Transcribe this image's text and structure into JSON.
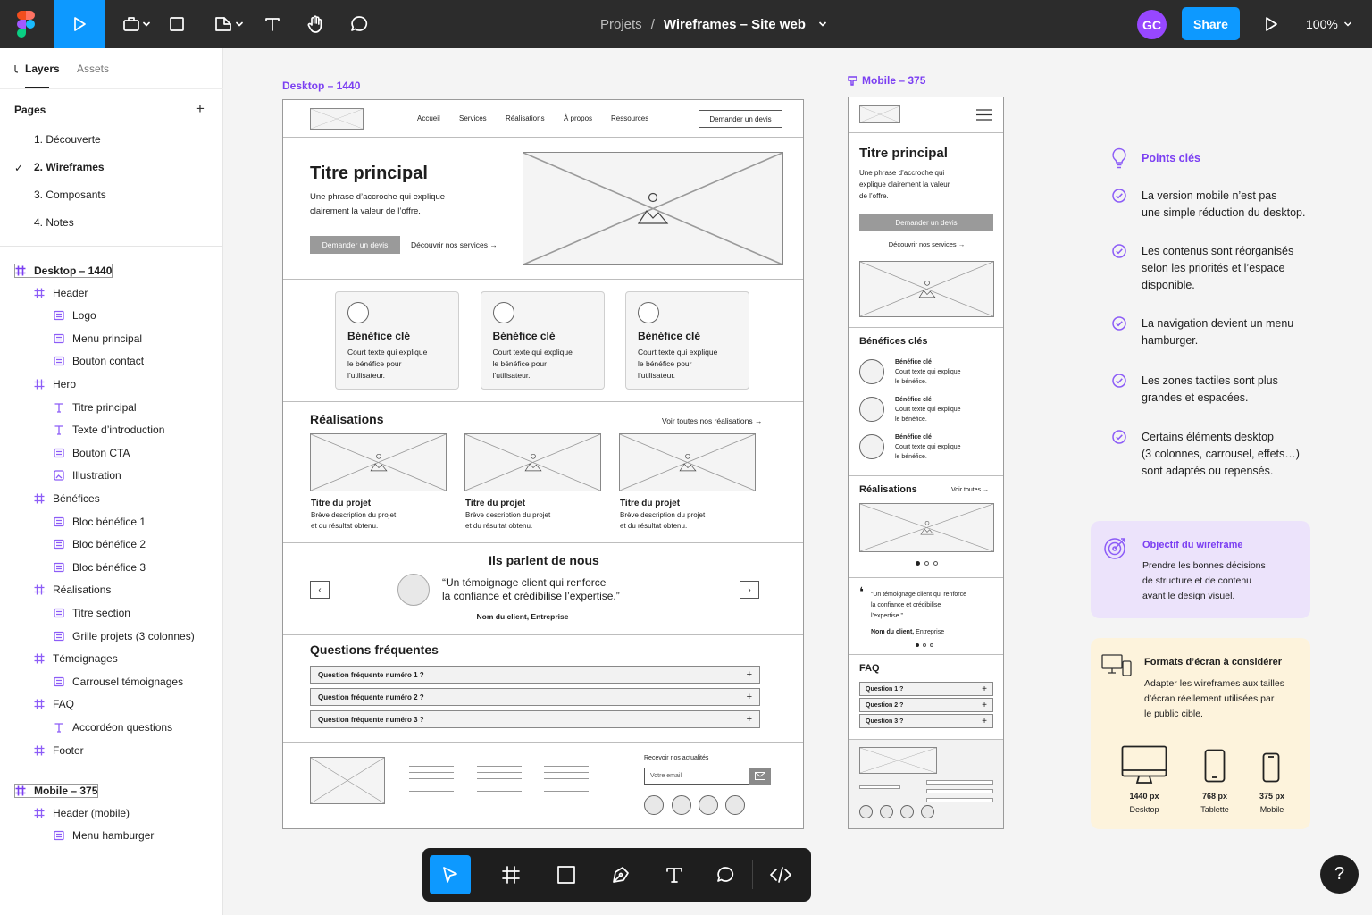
{
  "topbar": {
    "breadcrumb_parent": "Projets",
    "breadcrumb_sep": "/",
    "file_name": "Wireframes – Site web",
    "avatar": "GC",
    "share": "Share",
    "zoom": "100%"
  },
  "left_panel": {
    "tabs": {
      "layers": "Layers",
      "assets": "Assets"
    },
    "pages_title": "Pages",
    "pages": [
      "1. Découverte",
      "2. Wireframes",
      "3. Composants",
      "4. Notes"
    ],
    "current_page": "2. Wireframes",
    "layers": [
      {
        "label": "Desktop – 1440",
        "depth": 0,
        "kind": "frame"
      },
      {
        "label": "Header",
        "depth": 1,
        "kind": "frame"
      },
      {
        "label": "Logo",
        "depth": 2,
        "kind": "component"
      },
      {
        "label": "Menu principal",
        "depth": 2,
        "kind": "component"
      },
      {
        "label": "Bouton contact",
        "depth": 2,
        "kind": "component"
      },
      {
        "label": "Hero",
        "depth": 1,
        "kind": "frame"
      },
      {
        "label": "Titre principal",
        "depth": 2,
        "kind": "text"
      },
      {
        "label": "Texte d’introduction",
        "depth": 2,
        "kind": "text"
      },
      {
        "label": "Bouton CTA",
        "depth": 2,
        "kind": "component"
      },
      {
        "label": "Illustration",
        "depth": 2,
        "kind": "image"
      },
      {
        "label": "Bénéfices",
        "depth": 1,
        "kind": "frame"
      },
      {
        "label": "Bloc bénéfice 1",
        "depth": 2,
        "kind": "component"
      },
      {
        "label": "Bloc bénéfice 2",
        "depth": 2,
        "kind": "component"
      },
      {
        "label": "Bloc bénéfice 3",
        "depth": 2,
        "kind": "component"
      },
      {
        "label": "Réalisations",
        "depth": 1,
        "kind": "frame"
      },
      {
        "label": "Titre section",
        "depth": 2,
        "kind": "component"
      },
      {
        "label": "Grille projets (3 colonnes)",
        "depth": 2,
        "kind": "component"
      },
      {
        "label": "Témoignages",
        "depth": 1,
        "kind": "frame"
      },
      {
        "label": "Carrousel témoignages",
        "depth": 2,
        "kind": "component"
      },
      {
        "label": "FAQ",
        "depth": 1,
        "kind": "frame"
      },
      {
        "label": "Accordéon questions",
        "depth": 2,
        "kind": "text"
      },
      {
        "label": "Footer",
        "depth": 1,
        "kind": "frame"
      },
      {
        "label": "Mobile – 375",
        "depth": 0,
        "kind": "frame"
      },
      {
        "label": "Header (mobile)",
        "depth": 1,
        "kind": "frame"
      },
      {
        "label": "Menu hamburger",
        "depth": 2,
        "kind": "component"
      }
    ]
  },
  "desktop": {
    "label": "Desktop – 1440",
    "nav": [
      "Accueil",
      "Services",
      "Réalisations",
      "À propos",
      "Ressources"
    ],
    "contact_button": "Demander un devis",
    "hero_title": "Titre principal",
    "hero_text_1": "Une phrase d’accroche qui explique",
    "hero_text_2": "clairement la valeur de l’offre.",
    "hero_cta": "Demander un devis",
    "hero_link": "Découvrir nos services →",
    "benefits": [
      {
        "title": "Bénéfice clé",
        "l1": "Court texte qui explique",
        "l2": "le bénéfice pour",
        "l3": "l’utilisateur."
      },
      {
        "title": "Bénéfice clé",
        "l1": "Court texte qui explique",
        "l2": "le bénéfice pour",
        "l3": "l’utilisateur."
      },
      {
        "title": "Bénéfice clé",
        "l1": "Court texte qui explique",
        "l2": "le bénéfice pour",
        "l3": "l’utilisateur."
      }
    ],
    "projects_title": "Réalisations",
    "projects_link": "Voir toutes nos réalisations →",
    "projects": [
      {
        "title": "Titre du projet",
        "l1": "Brève description du projet",
        "l2": "et du résultat obtenu."
      },
      {
        "title": "Titre du projet",
        "l1": "Brève description du projet",
        "l2": "et du résultat obtenu."
      },
      {
        "title": "Titre du projet",
        "l1": "Brève description du projet",
        "l2": "et du résultat obtenu."
      }
    ],
    "testimonials_title": "Ils parlent de nous",
    "quote_1": "“Un témoignage client qui renforce",
    "quote_2": "la confiance et crédibilise l’expertise.”",
    "quote_author": "Nom du client, Entreprise",
    "faq_title": "Questions fréquentes",
    "faq": [
      "Question fréquente numéro 1 ?",
      "Question fréquente numéro 2 ?",
      "Question fréquente numéro 3 ?"
    ],
    "newsletter_label": "Recevoir nos actualités",
    "newsletter_placeholder": "Votre email"
  },
  "mobile": {
    "label": "Mobile – 375",
    "hero_title": "Titre principal",
    "hero_text_1": "Une phrase d’accroche qui",
    "hero_text_2": "explique clairement la valeur",
    "hero_text_3": "de l’offre.",
    "hero_cta": "Demander un devis",
    "hero_link": "Découvrir nos services →",
    "benefits_title": "Bénéfices clés",
    "benefits": [
      {
        "title": "Bénéfice clé",
        "l1": "Court texte qui explique",
        "l2": "le bénéfice."
      },
      {
        "title": "Bénéfice clé",
        "l1": "Court texte qui explique",
        "l2": "le bénéfice."
      },
      {
        "title": "Bénéfice clé",
        "l1": "Court texte qui explique",
        "l2": "le bénéfice."
      }
    ],
    "projects_title": "Réalisations",
    "projects_link": "Voir toutes →",
    "quote_1": "“Un témoignage client qui renforce",
    "quote_2": "la confiance et crédibilise",
    "quote_3": "l’expertise.”",
    "quote_author_bold": "Nom du client,",
    "quote_author_rest": " Entreprise",
    "faq_title": "FAQ",
    "faq": [
      "Question 1 ?",
      "Question 2 ?",
      "Question 3 ?"
    ]
  },
  "notes": {
    "key_points_title": "Points clés",
    "key_points": [
      [
        "La version mobile n’est pas",
        "une simple réduction du desktop."
      ],
      [
        "Les contenus sont réorganisés",
        "selon les priorités et l’espace",
        "disponible."
      ],
      [
        "La navigation devient un menu",
        "hamburger."
      ],
      [
        "Les zones tactiles sont plus",
        "grandes et espacées."
      ],
      [
        "Certains éléments desktop",
        "(3 colonnes, carrousel, effets…)",
        "sont adaptés ou repensés."
      ]
    ],
    "objective_title": "Objectif du wireframe",
    "objective_lines": [
      "Prendre les bonnes décisions",
      "de structure et de contenu",
      "avant le design visuel."
    ],
    "formats_title": "Formats d’écran à considérer",
    "formats_lines": [
      "Adapter les wireframes aux tailles",
      "d’écran réellement utilisées par",
      "le public cible."
    ],
    "devices": [
      {
        "size": "1440 px",
        "name": "Desktop"
      },
      {
        "size": "768 px",
        "name": "Tablette"
      },
      {
        "size": "375 px",
        "name": "Mobile"
      }
    ]
  },
  "help": "?",
  "colors": {
    "accent": "#7b3ff2",
    "share": "#0d99ff",
    "toolbar": "#2c2c2c",
    "active_tool": "#0d99ff"
  }
}
